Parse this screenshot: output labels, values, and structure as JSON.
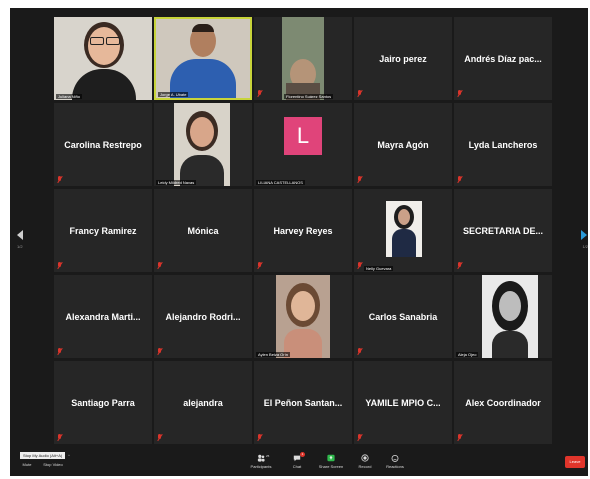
{
  "participants": {
    "juliana": {
      "label": "Juliana Niño"
    },
    "jorge": {
      "label": "Jorge A. Ubate"
    },
    "florentino": {
      "label": "Florentino Suárez Santos"
    },
    "jairo": {
      "name": "Jairo perez"
    },
    "andres": {
      "name": "Andrés Díaz pac..."
    },
    "carolina": {
      "name": "Carolina Restrepo"
    },
    "leidy": {
      "label": "Leidy Mildred Navas"
    },
    "liliana": {
      "label": "LILIANA CASTELLANOS",
      "initial": "L",
      "color": "#e0447a"
    },
    "mayra": {
      "name": "Mayra Agón"
    },
    "lyda": {
      "name": "Lyda Lancheros"
    },
    "francy": {
      "name": "Francy Ramirez"
    },
    "monica": {
      "name": "Mónica"
    },
    "harvey": {
      "name": "Harvey Reyes"
    },
    "nelly": {
      "label": "Nelly Guevara"
    },
    "secretaria": {
      "name": "SECRETARIA DE..."
    },
    "alexandra": {
      "name": "Alexandra Marti..."
    },
    "alejandro": {
      "name": "Alejandro Rodri..."
    },
    "aylen": {
      "label": "Aylen Beiza Orín"
    },
    "carlos": {
      "name": "Carlos Sanabria"
    },
    "alejaojeo": {
      "label": "Aleja Ojeo"
    },
    "santiago": {
      "name": "Santiago Parra"
    },
    "alejandra": {
      "name": "alejandra"
    },
    "penon": {
      "name": "El Peñon Santan..."
    },
    "yamile": {
      "name": "YAMILE MPIO C..."
    },
    "alex": {
      "name": "Alex Coordinador"
    }
  },
  "pager": {
    "left": "1/2",
    "right": "1/2"
  },
  "toolbar": {
    "tooltip": "Stop My Audio (Alt+A)",
    "mute": "Mute",
    "stop_video": "Stop Video",
    "participants": "Participants",
    "participants_count": "25",
    "chat": "Chat",
    "chat_badge": "1",
    "share_screen": "Share Screen",
    "record": "Record",
    "reactions": "Reactions",
    "leave": "Leave"
  },
  "colors": {
    "speaking": "#c8d43a",
    "share": "#2fb84c",
    "leave": "#e0352b",
    "mute": "#d9342b"
  }
}
